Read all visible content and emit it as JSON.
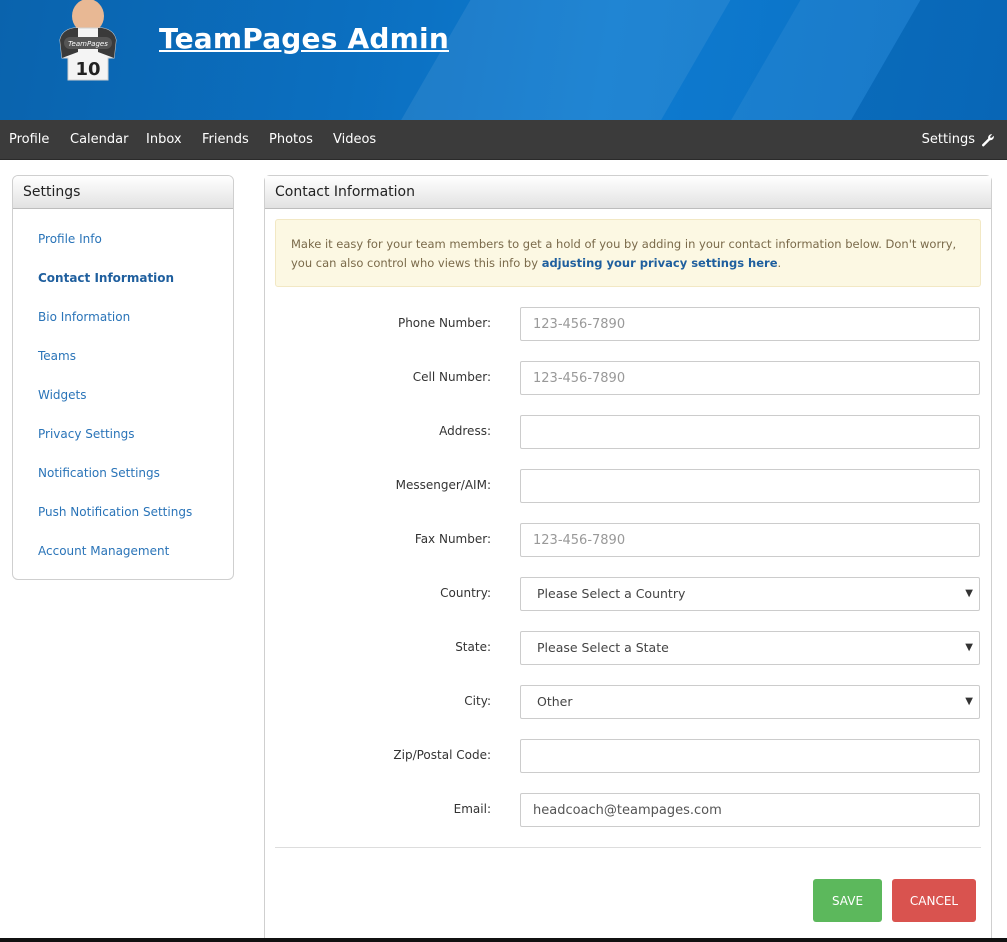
{
  "header": {
    "site_title": "TeamPages Admin",
    "logo_text": "TeamPages",
    "logo_number": "10"
  },
  "nav": {
    "items": [
      "Profile",
      "Calendar",
      "Inbox",
      "Friends",
      "Photos",
      "Videos"
    ],
    "settings_label": "Settings"
  },
  "sidebar": {
    "title": "Settings",
    "items": [
      {
        "label": "Profile Info",
        "active": false
      },
      {
        "label": "Contact Information",
        "active": true
      },
      {
        "label": "Bio Information",
        "active": false
      },
      {
        "label": "Teams",
        "active": false
      },
      {
        "label": "Widgets",
        "active": false
      },
      {
        "label": "Privacy Settings",
        "active": false
      },
      {
        "label": "Notification Settings",
        "active": false
      },
      {
        "label": "Push Notification Settings",
        "active": false
      },
      {
        "label": "Account Management",
        "active": false
      }
    ]
  },
  "main": {
    "title": "Contact Information",
    "notice": {
      "text": "Make it easy for your team members to get a hold of you by adding in your contact information below. Don't worry, you can also control who views this info by ",
      "link": "adjusting your privacy settings here",
      "suffix": "."
    },
    "fields": {
      "phone": {
        "label": "Phone Number:",
        "placeholder": "123-456-7890",
        "value": ""
      },
      "cell": {
        "label": "Cell Number:",
        "placeholder": "123-456-7890",
        "value": ""
      },
      "address": {
        "label": "Address:",
        "placeholder": "",
        "value": ""
      },
      "messenger": {
        "label": "Messenger/AIM:",
        "placeholder": "",
        "value": ""
      },
      "fax": {
        "label": "Fax Number:",
        "placeholder": "123-456-7890",
        "value": ""
      },
      "country": {
        "label": "Country:",
        "selected": "Please Select a Country"
      },
      "state": {
        "label": "State:",
        "selected": "Please Select a State"
      },
      "city": {
        "label": "City:",
        "selected": "Other"
      },
      "zip": {
        "label": "Zip/Postal Code:",
        "placeholder": "",
        "value": ""
      },
      "email": {
        "label": "Email:",
        "placeholder": "",
        "value": "headcoach@teampages.com"
      }
    },
    "buttons": {
      "save": "SAVE",
      "cancel": "CANCEL"
    }
  },
  "colors": {
    "banner_blue": "#0b6fc0",
    "nav_bg": "#3b3b3b",
    "link_blue": "#2a74b8",
    "save_green": "#5cb85c",
    "cancel_red": "#d9534f",
    "notice_bg": "#fcf8e3"
  }
}
